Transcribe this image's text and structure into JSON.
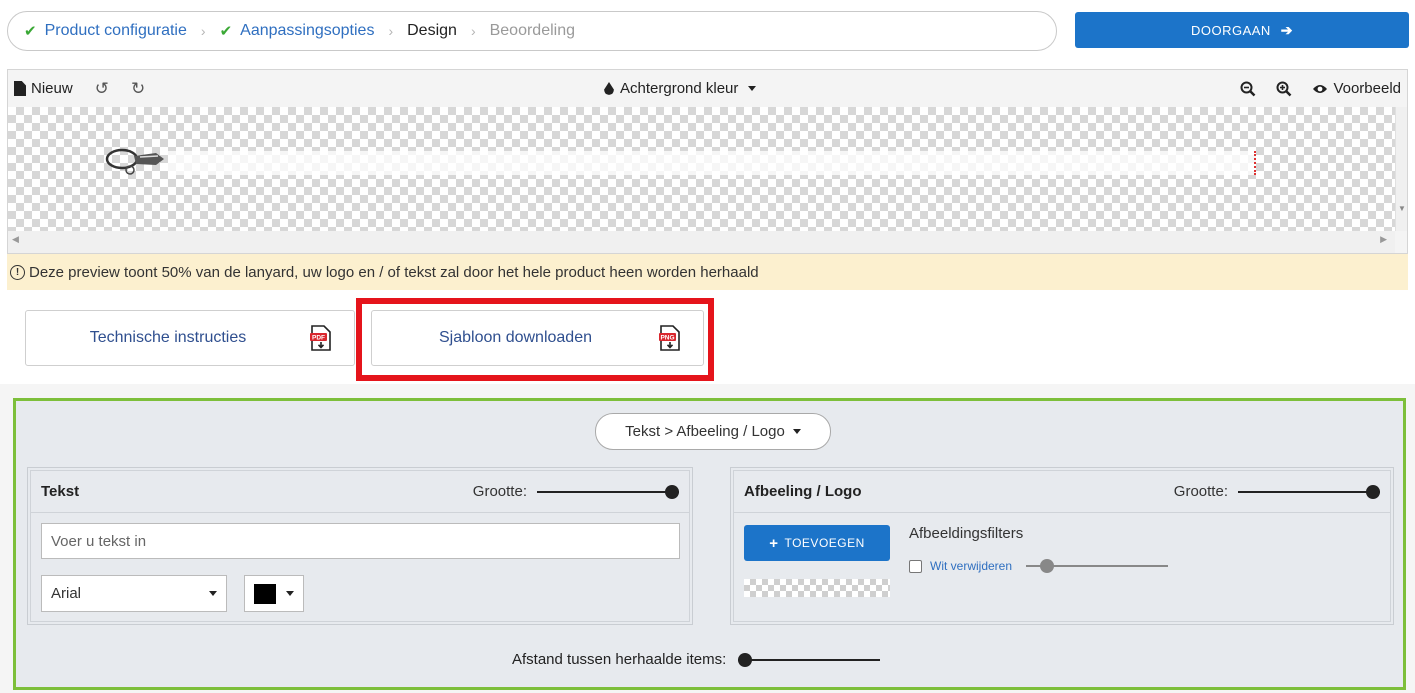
{
  "breadcrumb": {
    "steps": [
      {
        "label": "Product configuratie",
        "state": "done"
      },
      {
        "label": "Aanpassingsopties",
        "state": "done"
      },
      {
        "label": "Design",
        "state": "current"
      },
      {
        "label": "Beoordeling",
        "state": "todo"
      }
    ]
  },
  "continue_button": {
    "label": "DOORGAAN"
  },
  "toolbar": {
    "new_label": "Nieuw",
    "background_label": "Achtergrond kleur",
    "preview_label": "Voorbeeld"
  },
  "notice": {
    "text": "Deze preview toont 50% van de lanyard, uw logo en / of tekst zal door het hele product heen worden herhaald"
  },
  "downloads": {
    "technical": {
      "label": "Technische instructies",
      "badge": "PDF"
    },
    "template": {
      "label": "Sjabloon downloaden",
      "badge": "PNG"
    }
  },
  "mode_select": {
    "label": "Tekst > Afbeeling / Logo"
  },
  "text_panel": {
    "title": "Tekst",
    "size_label": "Grootte:",
    "size_value": 1.0,
    "input_placeholder": "Voer u tekst in",
    "font": "Arial",
    "color": "#000000"
  },
  "image_panel": {
    "title": "Afbeeling / Logo",
    "size_label": "Grootte:",
    "size_value": 1.0,
    "add_label": "TOEVOEGEN",
    "filters_title": "Afbeeldingsfilters",
    "remove_white_label": "Wit verwijderen",
    "remove_white_checked": false,
    "remove_white_value": 0.1
  },
  "spacing": {
    "label": "Afstand tussen herhaalde items:",
    "value": 0.0
  },
  "colors": {
    "primary": "#1c74c9",
    "success": "#3aa835",
    "panel_border": "#7dbf3a",
    "highlight": "#e5141b",
    "notice_bg": "#fcf0cf"
  }
}
